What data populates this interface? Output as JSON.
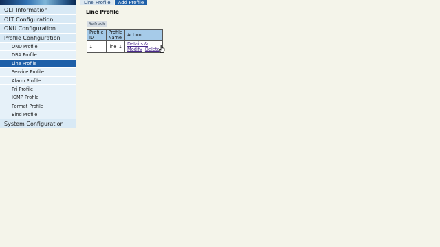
{
  "tabs": [
    {
      "label": "Line Profile",
      "active": false
    },
    {
      "label": "Add Profile",
      "active": true
    }
  ],
  "sidebar": {
    "items": [
      {
        "label": "OLT Information",
        "level": "top",
        "active": false
      },
      {
        "label": "OLT Configuration",
        "level": "top",
        "active": false
      },
      {
        "label": "ONU Configuration",
        "level": "top",
        "active": false
      },
      {
        "label": "Profile Configuration",
        "level": "top",
        "active": false
      },
      {
        "label": "ONU Profile",
        "level": "sub",
        "active": false
      },
      {
        "label": "DBA Profile",
        "level": "sub",
        "active": false
      },
      {
        "label": "Line Profile",
        "level": "sub",
        "active": true
      },
      {
        "label": "Service Profile",
        "level": "sub",
        "active": false
      },
      {
        "label": "Alarm Profile",
        "level": "sub",
        "active": false
      },
      {
        "label": "Pri Profile",
        "level": "sub",
        "active": false
      },
      {
        "label": "IGMP Profile",
        "level": "sub",
        "active": false
      },
      {
        "label": "Format Profile",
        "level": "sub",
        "active": false
      },
      {
        "label": "Bind Profile",
        "level": "sub",
        "active": false
      },
      {
        "label": "System Configuration",
        "level": "top",
        "active": false
      }
    ]
  },
  "main": {
    "title": "Line Profile",
    "refresh_label": "Refresh",
    "table": {
      "headers": [
        "Profile ID",
        "Profile Name",
        "Action"
      ],
      "rows": [
        {
          "id": "1",
          "name": "line_1",
          "actions": [
            "Details & Modify",
            "Delete"
          ]
        }
      ]
    }
  },
  "colors": {
    "page_bg": "#f4f4ea",
    "nav_bg": "#d8e9f5",
    "nav_active": "#1e5fa8",
    "table_header": "#a6cbe9",
    "link": "#4a2a8a"
  },
  "icons": {
    "cursor": "hand-pointer-icon"
  }
}
